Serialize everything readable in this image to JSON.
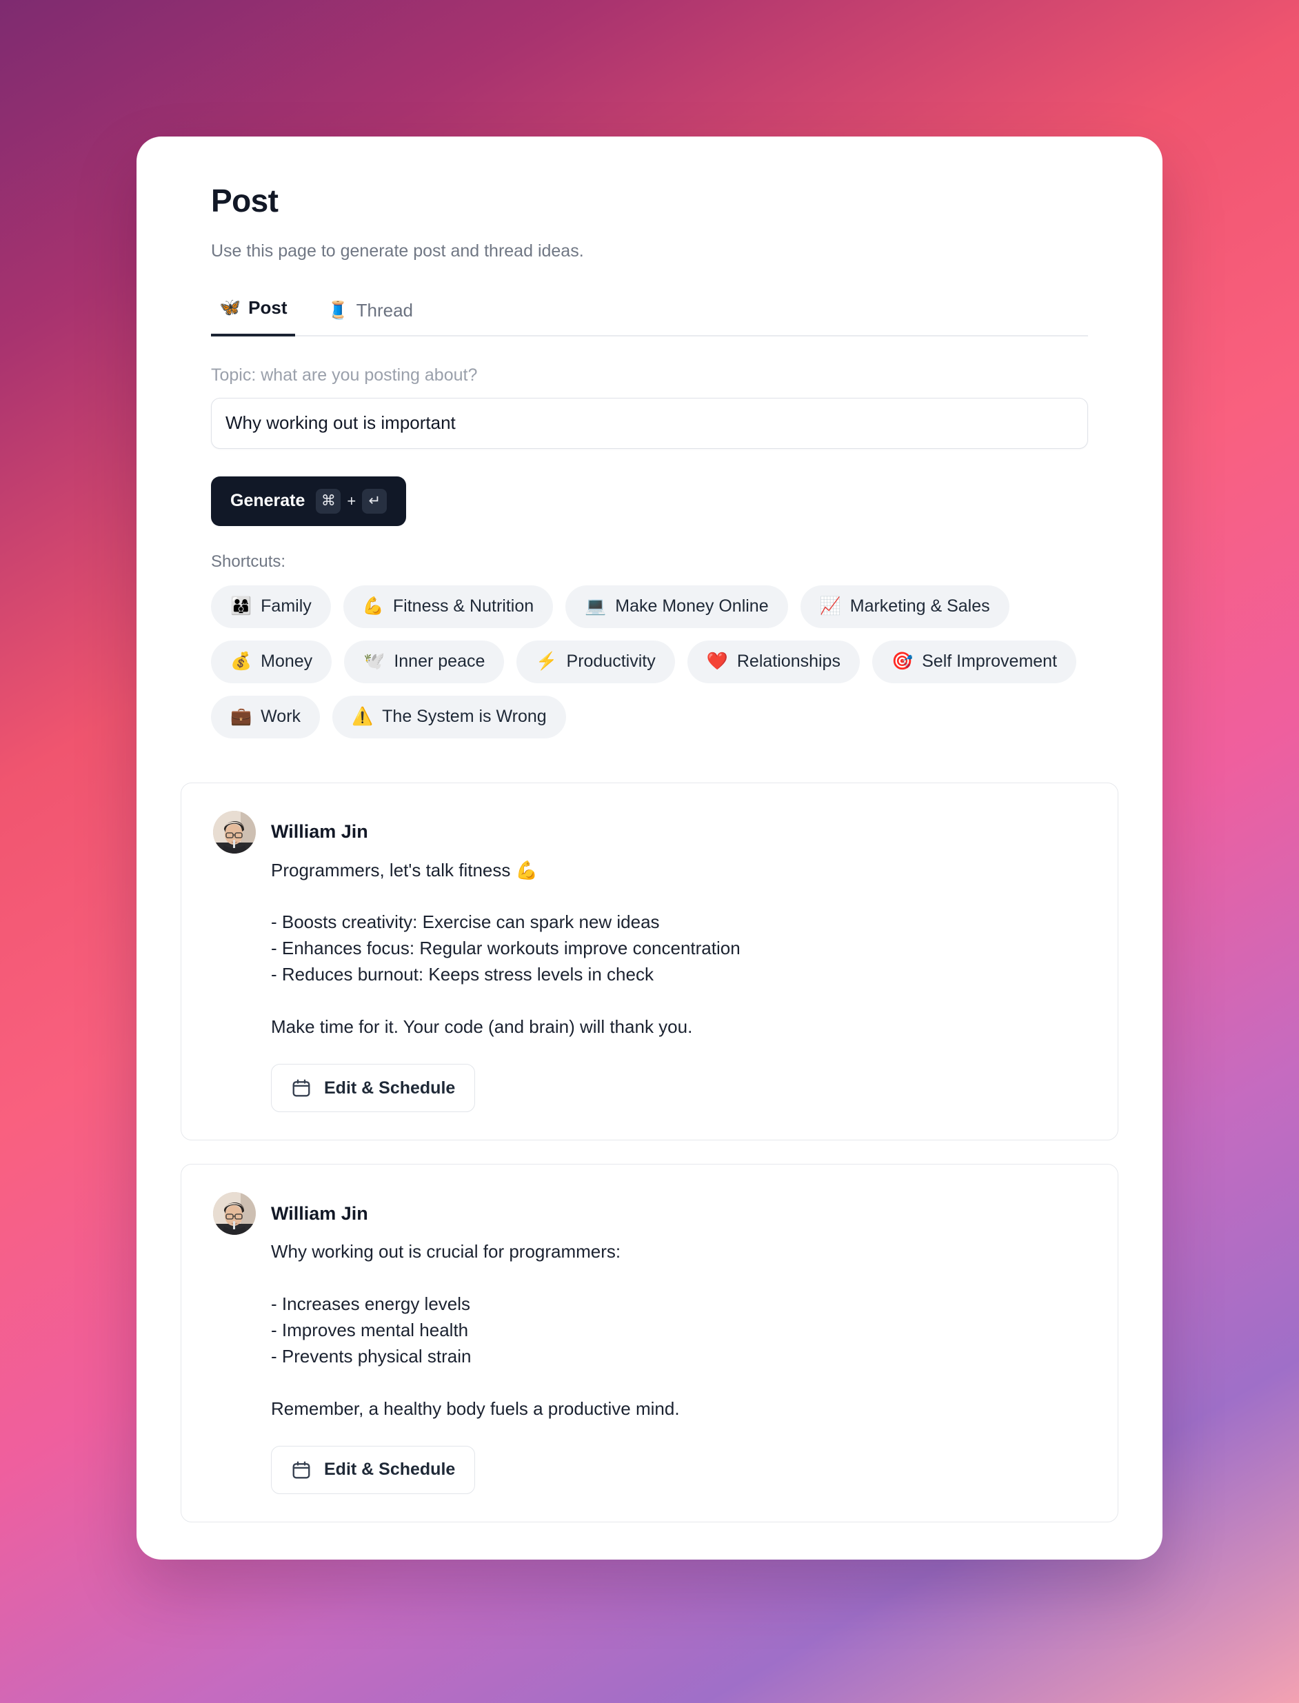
{
  "page": {
    "title": "Post",
    "subtitle": "Use this page to generate post and thread ideas."
  },
  "tabs": [
    {
      "emoji": "🦋",
      "icon_name": "butterfly-icon",
      "label": "Post",
      "active": true
    },
    {
      "emoji": "🧵",
      "icon_name": "thread-spool-icon",
      "label": "Thread",
      "active": false
    }
  ],
  "form": {
    "topic_label": "Topic: what are you posting about?",
    "topic_value": "Why working out is important",
    "topic_placeholder": "Topic: what are you posting about?",
    "generate_label": "Generate",
    "key_command": "⌘",
    "key_plus": "+",
    "key_enter": "↵"
  },
  "shortcuts": {
    "label": "Shortcuts:",
    "chips": [
      {
        "emoji": "👨‍👩‍👦",
        "icon_name": "family-icon",
        "label": "Family"
      },
      {
        "emoji": "💪",
        "icon_name": "flexed-biceps-icon",
        "label": "Fitness & Nutrition"
      },
      {
        "emoji": "💻",
        "icon_name": "laptop-icon",
        "label": "Make Money Online"
      },
      {
        "emoji": "📈",
        "icon_name": "chart-increasing-icon",
        "label": "Marketing & Sales"
      },
      {
        "emoji": "💰",
        "icon_name": "money-bag-icon",
        "label": "Money"
      },
      {
        "emoji": "🕊️",
        "icon_name": "dove-icon",
        "label": "Inner peace"
      },
      {
        "emoji": "⚡",
        "icon_name": "lightning-icon",
        "label": "Productivity"
      },
      {
        "emoji": "❤️",
        "icon_name": "red-heart-icon",
        "label": "Relationships"
      },
      {
        "emoji": "🎯",
        "icon_name": "bullseye-icon",
        "label": "Self Improvement"
      },
      {
        "emoji": "💼",
        "icon_name": "briefcase-icon",
        "label": "Work"
      },
      {
        "emoji": "⚠️",
        "icon_name": "warning-icon",
        "label": "The System is Wrong"
      }
    ]
  },
  "results": [
    {
      "author": "William Jin",
      "body": "Programmers, let's talk fitness 💪\n\n- Boosts creativity: Exercise can spark new ideas\n- Enhances focus: Regular workouts improve concentration\n- Reduces burnout: Keeps stress levels in check\n\nMake time for it. Your code (and brain) will thank you.",
      "action_label": "Edit & Schedule"
    },
    {
      "author": "William Jin",
      "body": "Why working out is crucial for programmers:\n\n- Increases energy levels\n- Improves mental health\n- Prevents physical strain\n\nRemember, a healthy body fuels a productive mind.",
      "action_label": "Edit & Schedule"
    }
  ],
  "colors": {
    "accent_dark": "#111827",
    "tab_active_underline": "#1b2433",
    "chip_bg": "#f1f3f6",
    "muted_text": "#707784"
  }
}
